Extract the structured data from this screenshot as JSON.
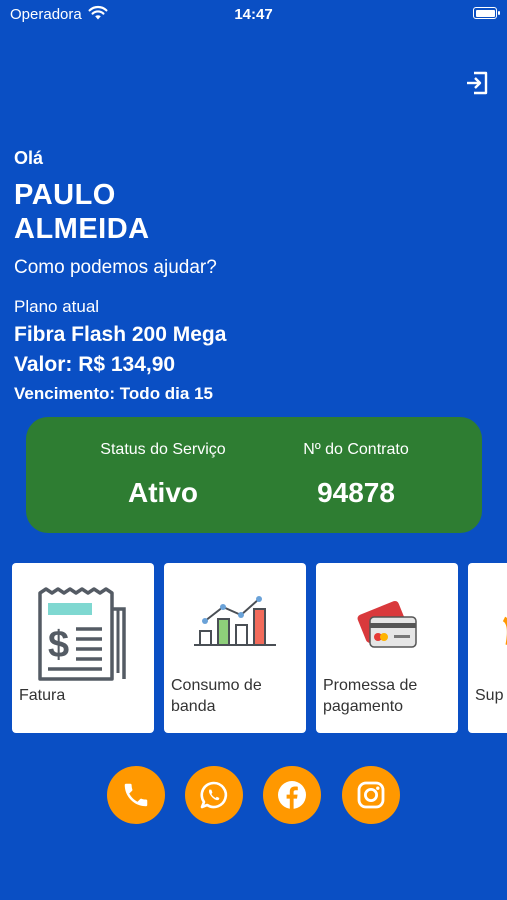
{
  "status_bar": {
    "carrier": "Operadora",
    "time": "14:47"
  },
  "header": {
    "logout_icon": "logout-icon"
  },
  "greeting": {
    "hello": "Olá",
    "name": "PAULO\nALMEIDA",
    "help": "Como podemos ajudar?"
  },
  "plan": {
    "label": "Plano atual",
    "name": "Fibra Flash 200 Mega",
    "value": "Valor: R$ 134,90",
    "due": "Vencimento: Todo dia 15"
  },
  "status_card": {
    "status_label": "Status do Serviço",
    "status_value": "Ativo",
    "contract_label": "Nº do Contrato",
    "contract_value": "94878",
    "color": "#2e7d32"
  },
  "tiles": [
    {
      "label": "Fatura",
      "icon": "invoice-icon"
    },
    {
      "label": "Consumo de banda",
      "icon": "bandwidth-chart-icon"
    },
    {
      "label": "Promessa de pagamento",
      "icon": "credit-card-icon"
    },
    {
      "label": "Sup",
      "icon": "support-icon"
    }
  ],
  "social": [
    {
      "name": "phone",
      "icon": "phone-icon"
    },
    {
      "name": "whatsapp",
      "icon": "whatsapp-icon"
    },
    {
      "name": "facebook",
      "icon": "facebook-icon"
    },
    {
      "name": "instagram",
      "icon": "instagram-icon"
    }
  ],
  "colors": {
    "background": "#0a4fc4",
    "accent": "#ff9800",
    "status_green": "#2e7d32"
  }
}
